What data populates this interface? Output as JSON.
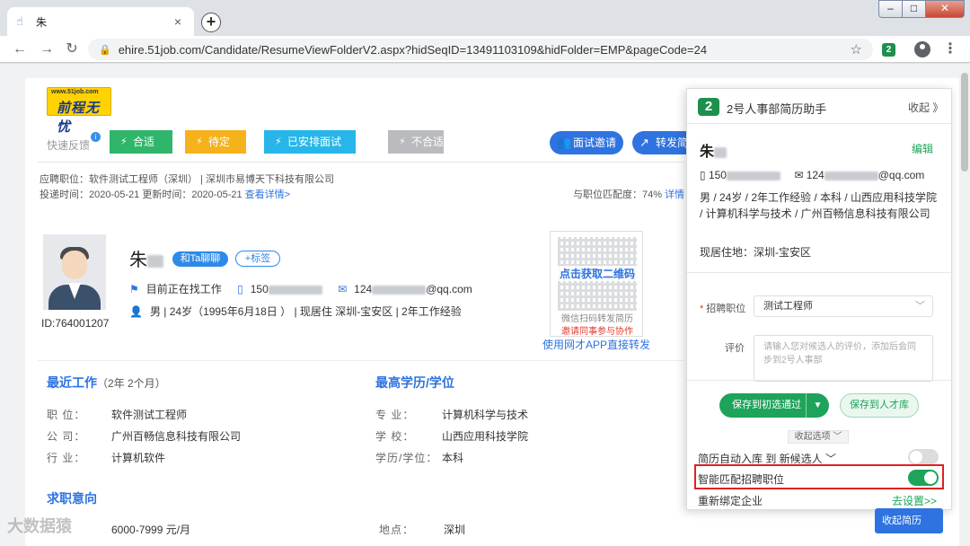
{
  "browser": {
    "tab_title": "朱",
    "tab_close": "×",
    "new_tab": "+",
    "url": "ehire.51job.com/Candidate/ResumeViewFolderV2.aspx?hidSeqID=13491103109&hidFolder=EMP&pageCode=24",
    "extension_badge": "2",
    "window_controls": {
      "minimize": "–",
      "maximize": "□",
      "close": "✕"
    }
  },
  "logo": {
    "url": "www.51job.com",
    "text": "前程无忧"
  },
  "feedback": {
    "label": "快速反馈",
    "info": "i",
    "buttons": [
      "合适",
      "待定",
      "已安排面试",
      "不合适"
    ]
  },
  "actions": {
    "interview": "面试邀请",
    "forward": "转发简历"
  },
  "meta": {
    "line1": "应聘职位：软件测试工程师（深圳）   |   深圳市易博天下科技有限公司",
    "line2_prefix": "投递时间：2020-05-21    更新时间：2020-05-21",
    "line2_link": "查看详情>",
    "match": "与职位匹配度：74%",
    "match_link": "详情"
  },
  "candidate": {
    "id": "ID:764001207",
    "name": "朱",
    "chat": "和Ta聊聊",
    "tag": "+标签",
    "status": "目前正在找工作",
    "phone_prefix": "150",
    "email_suffix": "@qq.com",
    "email_prefix": "124",
    "basic": "男  |  24岁（1995年6月18日 ）  |  现居住 深圳-宝安区  |  2年工作经验"
  },
  "qr": {
    "get": "点击获取二维码",
    "hint1": "微信扫码转发简历",
    "hint2": "邀请同事参与协作",
    "link": "使用网才APP直接转发"
  },
  "recent_work": {
    "title": "最近工作",
    "duration": "（2年 2个月）",
    "rows": [
      {
        "k": "职    位：",
        "v": "软件测试工程师"
      },
      {
        "k": "公    司：",
        "v": "广州百畅信息科技有限公司"
      },
      {
        "k": "行    业：",
        "v": "计算机软件"
      }
    ]
  },
  "education": {
    "title": "最高学历/学位",
    "rows": [
      {
        "k": "专    业：",
        "v": "计算机科学与技术"
      },
      {
        "k": "学    校：",
        "v": "山西应用科技学院"
      },
      {
        "k": "学历/学位：",
        "v": "本科"
      }
    ]
  },
  "intent": {
    "title": "求职意向",
    "salary": "6000-7999 元/月",
    "location_k": "地点：",
    "location_v": "深圳"
  },
  "watermark": "大数据猿",
  "panel": {
    "logo": "2",
    "title": "2号人事部简历助手",
    "collapse": "收起 》",
    "name": "朱",
    "edit": "编辑",
    "phone_prefix": "150",
    "email_prefix": "124",
    "email_suffix": "@qq.com",
    "desc": "男 / 24岁 / 2年工作经验 / 本科 / 山西应用科技学院 / 计算机科学与技术 / 广州百畅信息科技有限公司",
    "location": "现居住地：深圳-宝安区",
    "position_label": "招聘职位",
    "position_value": "测试工程师",
    "review_label": "评价",
    "review_placeholder": "请输入您对候选人的评价，添加后会同步到2号人事部",
    "save_primary": "保存到初选通过",
    "save_secondary": "保存到人才库",
    "fold": "收起选项 ﹀",
    "auto_label": "简历自动入库  到  新候选人  ﹀",
    "auto_on": false,
    "smart_label": "智能匹配招聘职位",
    "smart_on": true,
    "rebind": "重新绑定企业",
    "goto": "去设置>>"
  },
  "corner_button": "收起简历"
}
